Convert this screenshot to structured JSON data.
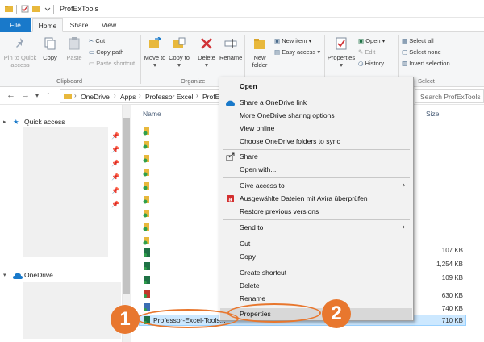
{
  "window": {
    "title": "ProfExTools"
  },
  "ribbon_tabs": [
    "File",
    "Home",
    "Share",
    "View"
  ],
  "ribbon": {
    "pin_to_quick_access": "Pin to Quick access",
    "copy": "Copy",
    "paste": "Paste",
    "cut": "Cut",
    "copy_path": "Copy path",
    "paste_shortcut": "Paste shortcut",
    "clipboard_group": "Clipboard",
    "move_to": "Move to",
    "copy_to": "Copy to",
    "delete": "Delete",
    "rename": "Rename",
    "organize_group": "Organize",
    "new_folder": "New folder",
    "new_item": "New item",
    "easy_access": "Easy access",
    "properties": "Properties",
    "open": "Open",
    "edit": "Edit",
    "history": "History",
    "select_all": "Select all",
    "select_none": "Select none",
    "invert_selection": "Invert selection",
    "select_group": "Select"
  },
  "address": {
    "breadcrumbs": [
      "OneDrive",
      "Apps",
      "Professor Excel",
      "ProfEx"
    ],
    "search_placeholder": "Search ProfExTools"
  },
  "navpane": {
    "quick_access": "Quick access",
    "onedrive": "OneDrive"
  },
  "filelist": {
    "col_name": "Name",
    "col_size": "Size",
    "sizes": [
      "107 KB",
      "1,254 KB",
      "109 KB",
      "630 KB",
      "740 KB",
      "710 KB"
    ],
    "selected_file": "Professor-Excel-Tools..."
  },
  "context_menu": {
    "items": [
      "Open",
      "Share a OneDrive link",
      "More OneDrive sharing options",
      "View online",
      "Choose OneDrive folders to sync",
      "Share",
      "Open with...",
      "Give access to",
      "Ausgewählte Dateien mit Avira überprüfen",
      "Restore previous versions",
      "Send to",
      "Cut",
      "Copy",
      "Create shortcut",
      "Delete",
      "Rename",
      "Properties"
    ]
  },
  "callouts": [
    "1",
    "2"
  ],
  "colors": {
    "accent": "#1979ca",
    "callout": "#e8772e",
    "selection": "#cce8ff",
    "excel_green": "#1e7145"
  }
}
